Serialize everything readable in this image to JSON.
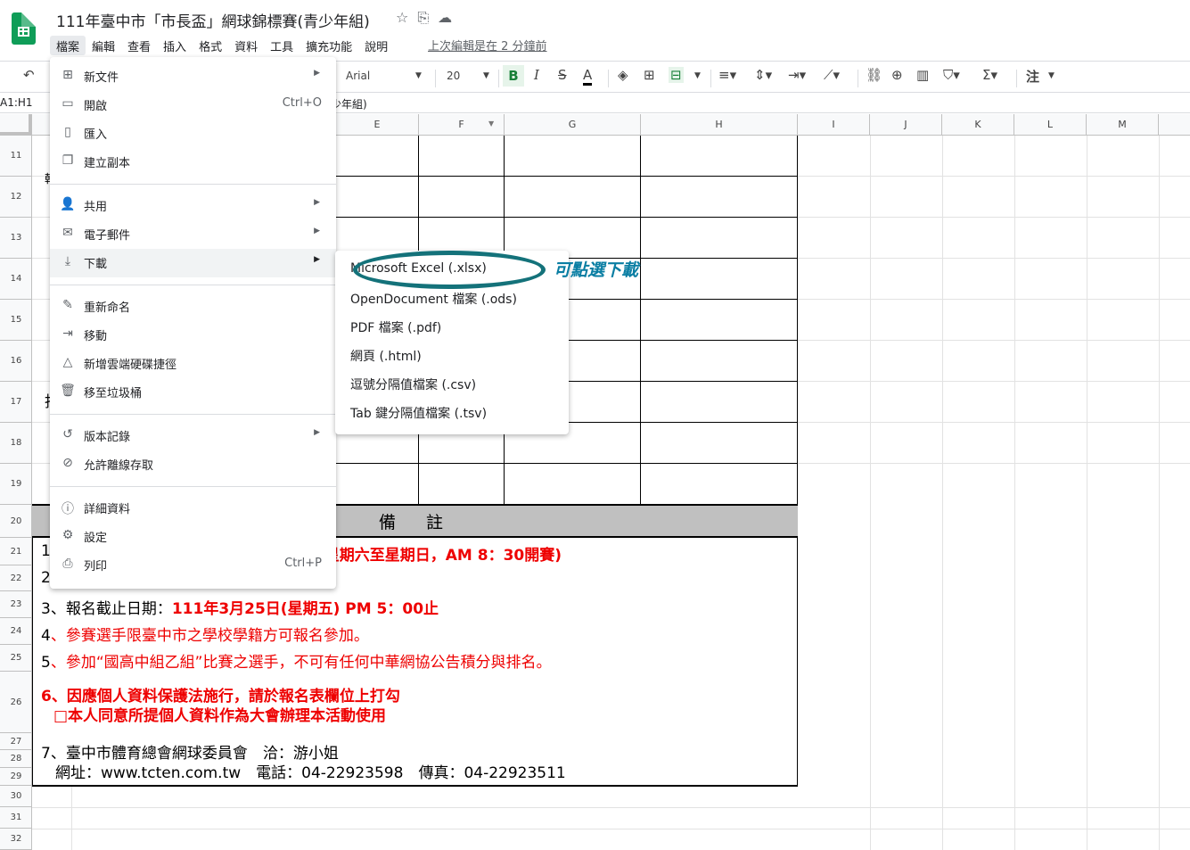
{
  "window": {
    "title": "111年臺中市「市長盃」網球錦標賽(青少年組)",
    "icons": [
      "star-icon",
      "move-folder-icon",
      "cloud-status-icon"
    ]
  },
  "menubar": {
    "items": [
      "檔案",
      "編輯",
      "查看",
      "插入",
      "格式",
      "資料",
      "工具",
      "擴充功能",
      "說明"
    ],
    "last_edit": "上次編輯是在 2 分鐘前"
  },
  "toolbar": {
    "font": "Arial",
    "font_size": "20",
    "bold": "B",
    "italic": "I",
    "strike": "S",
    "text_color": "A",
    "input_tools": "注"
  },
  "formula_bar": {
    "name_box": "A1:H1",
    "content_fragment": "少年組)"
  },
  "columns": [
    "E",
    "F",
    "G",
    "H",
    "I",
    "J",
    "K",
    "L",
    "M"
  ],
  "rows": [
    "11",
    "12",
    "13",
    "14",
    "15",
    "16",
    "17",
    "18",
    "19",
    "20",
    "21",
    "22",
    "23",
    "24",
    "25",
    "26",
    "27",
    "28",
    "29",
    "30",
    "31",
    "32"
  ],
  "file_menu": {
    "items": [
      {
        "label": "新文件",
        "icon": "plus-box-icon",
        "submenu": true
      },
      {
        "label": "開啟",
        "icon": "folder-icon",
        "shortcut": "Ctrl+O"
      },
      {
        "label": "匯入",
        "icon": "file-icon"
      },
      {
        "label": "建立副本",
        "icon": "copy-icon"
      },
      {
        "label": "共用",
        "icon": "person-add-icon",
        "submenu": true
      },
      {
        "label": "電子郵件",
        "icon": "mail-icon",
        "submenu": true
      },
      {
        "label": "下載",
        "icon": "download-icon",
        "submenu": true
      },
      {
        "label": "重新命名",
        "icon": "rename-icon"
      },
      {
        "label": "移動",
        "icon": "move-icon"
      },
      {
        "label": "新增雲端硬碟捷徑",
        "icon": "drive-shortcut-icon"
      },
      {
        "label": "移至垃圾桶",
        "icon": "trash-icon"
      },
      {
        "label": "版本記錄",
        "icon": "history-icon",
        "submenu": true
      },
      {
        "label": "允許離線存取",
        "icon": "offline-icon"
      },
      {
        "label": "詳細資料",
        "icon": "info-icon"
      },
      {
        "label": "設定",
        "icon": "gear-icon"
      },
      {
        "label": "列印",
        "icon": "print-icon",
        "shortcut": "Ctrl+P"
      }
    ]
  },
  "download_submenu": {
    "items": [
      "Microsoft Excel (.xlsx)",
      "OpenDocument 檔案 (.ods)",
      "PDF 檔案 (.pdf)",
      "網頁 (.html)",
      "逗號分隔值檔案 (.csv)",
      "Tab 鍵分隔值檔案 (.tsv)"
    ]
  },
  "annotation": {
    "callout": "可點選下載",
    "color": "#14727a"
  },
  "sheet": {
    "remarks_header": "備註",
    "col_a_fragments": {
      "row12": "韓",
      "row17": "指"
    },
    "note1_number": "1",
    "note1_red": "日(星期六至星期日，AM 8：30開賽)",
    "note2_number": "2",
    "note3_black": "3、報名截止日期：",
    "note3_red": "111年3月25日(星期五) PM 5：00止",
    "note4_number": "4",
    "note4_red": "、參賽選手限臺中市之學校學籍方可報名參加。",
    "note5_number": "5",
    "note5_red": "、參加“國高中組乙組”比賽之選手，不可有任何中華網協公告積分與排名。",
    "note6_line1": "6、因應個人資料保護法施行，請於報名表欄位上打勾",
    "note6_line2": "□本人同意所提個人資料作為大會辦理本活動使用",
    "note7_line1": "7、臺中市體育總會網球委員會　洽：游小姐",
    "note7_line2": "網址：www.tcten.com.tw　電話：04-22923598　傳真：04-22923511",
    "red_color": "#ee0000"
  }
}
